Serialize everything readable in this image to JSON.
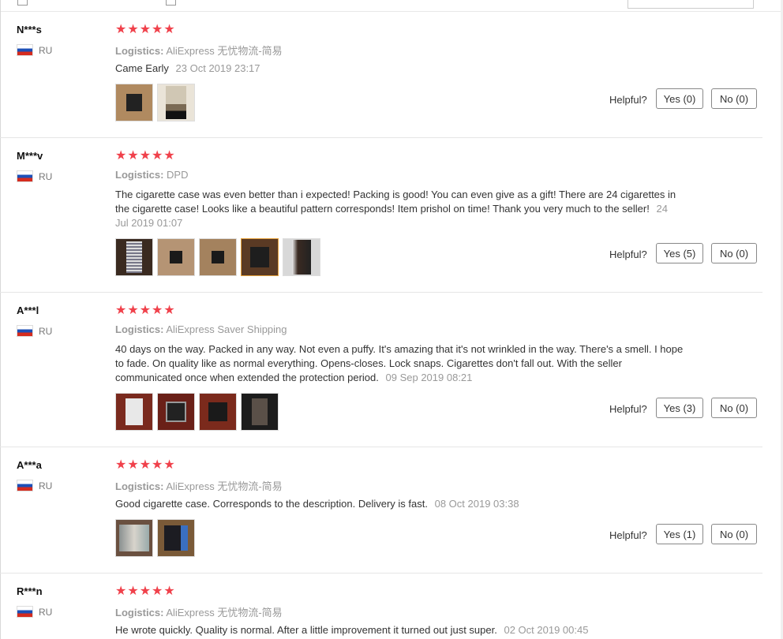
{
  "labels": {
    "helpful": "Helpful?",
    "logistics": "Logistics:"
  },
  "colors": {
    "star": "#f0414b",
    "border": "#e6e6e6",
    "selected_thumb": "#e6a23c"
  },
  "icons": {
    "star": "star-icon",
    "flag": "russia-flag-icon"
  },
  "reviews": [
    {
      "user": "N***s",
      "country": "RU",
      "stars": "★★★★★",
      "logistics": "AliExpress 无忧物流-简易",
      "text": "Came Early",
      "date": "23 Oct 2019 23:17",
      "yes": "Yes (0)",
      "no": "No (0)"
    },
    {
      "user": "M***v",
      "country": "RU",
      "stars": "★★★★★",
      "logistics": "DPD",
      "text": "The cigarette case was even better than i expected! Packing is good! You can even give as a gift! There are 24 cigarettes in the cigarette case! Looks like a beautiful pattern corresponds! Item prishol on time! Thank you very much to the seller!",
      "date": "24 Jul 2019 01:07",
      "yes": "Yes (5)",
      "no": "No (0)"
    },
    {
      "user": "A***l",
      "country": "RU",
      "stars": "★★★★★",
      "logistics": "AliExpress Saver Shipping",
      "text": "40 days on the way. Packed in any way. Not even a puffy. It's amazing that it's not wrinkled in the way. There's a smell. I hope to fade. On quality like as normal everything. Opens-closes. Lock snaps. Cigarettes don't fall out. With the seller communicated once when extended the protection period.",
      "date": "09 Sep 2019 08:21",
      "yes": "Yes (3)",
      "no": "No (0)"
    },
    {
      "user": "A***a",
      "country": "RU",
      "stars": "★★★★★",
      "logistics": "AliExpress 无忧物流-简易",
      "text": "Good cigarette case. Corresponds to the description. Delivery is fast.",
      "date": "08 Oct 2019 03:38",
      "yes": "Yes (1)",
      "no": "No (0)"
    },
    {
      "user": "R***n",
      "country": "RU",
      "stars": "★★★★★",
      "logistics": "AliExpress 无忧物流-简易",
      "text": "He wrote quickly. Quality is normal. After a little improvement it turned out just super.",
      "date": "02 Oct 2019 00:45"
    }
  ]
}
